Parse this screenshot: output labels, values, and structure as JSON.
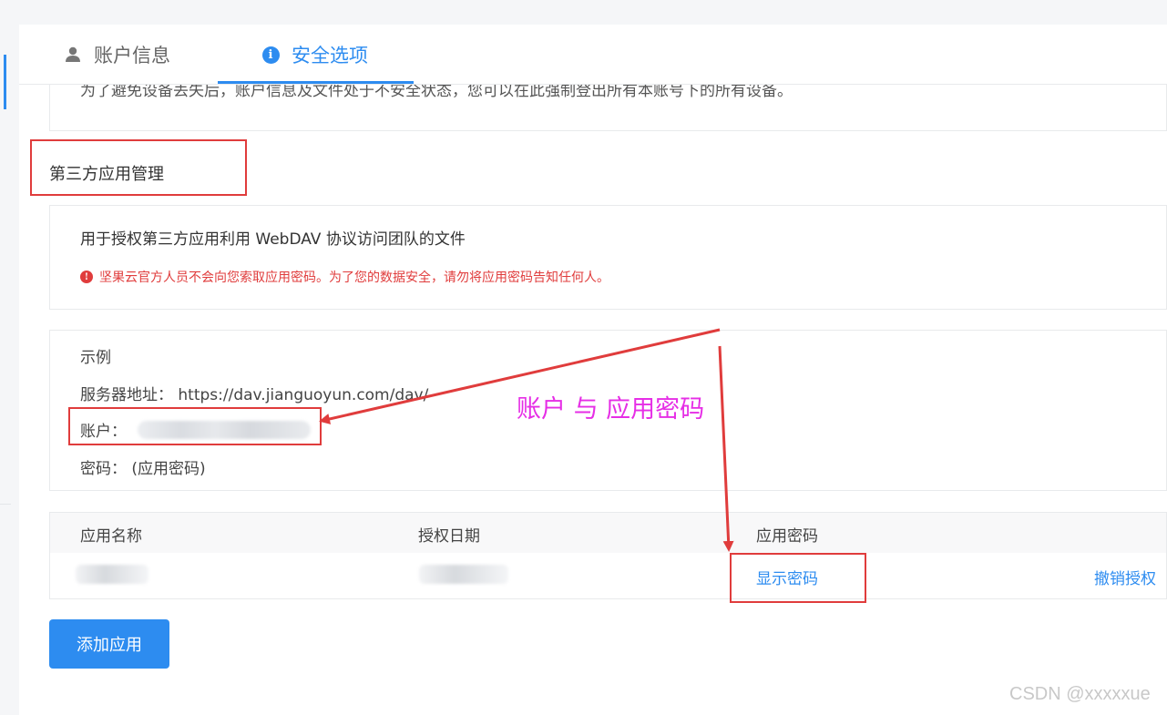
{
  "tabs": [
    {
      "label": "账户信息",
      "icon": "user-icon",
      "active": false
    },
    {
      "label": "安全选项",
      "icon": "info-icon",
      "active": true
    }
  ],
  "previous_section": {
    "text": "为了避免设备丢失后，账户信息及文件处于不安全状态，您可以在此强制登出所有本账号下的所有设备。"
  },
  "third_party": {
    "title": "第三方应用管理",
    "description": "用于授权第三方应用利用 WebDAV 协议访问团队的文件",
    "warning_icon": "!",
    "warning": "坚果云官方人员不会向您索取应用密码。为了您的数据安全，请勿将应用密码告知任何人。",
    "warning_color": "#e03c3c"
  },
  "example": {
    "title": "示例",
    "server_label": "服务器地址：",
    "server_value": "https://dav.jianguoyun.com/dav/",
    "account_label": "账户：",
    "password_label": "密码：",
    "password_value": "(应用密码)"
  },
  "table": {
    "headers": [
      "应用名称",
      "授权日期",
      "应用密码"
    ],
    "rows": [
      {
        "show_password": "显示密码",
        "revoke": "撤销授权"
      }
    ]
  },
  "add_button": "添加应用",
  "annotation": {
    "text": "账户 与 应用密码",
    "color": "#e62ee6",
    "box_color": "#e03c3c"
  },
  "watermark": "CSDN @xxxxxue",
  "colors": {
    "accent": "#2d8cf0",
    "background": "#f5f6f8"
  }
}
